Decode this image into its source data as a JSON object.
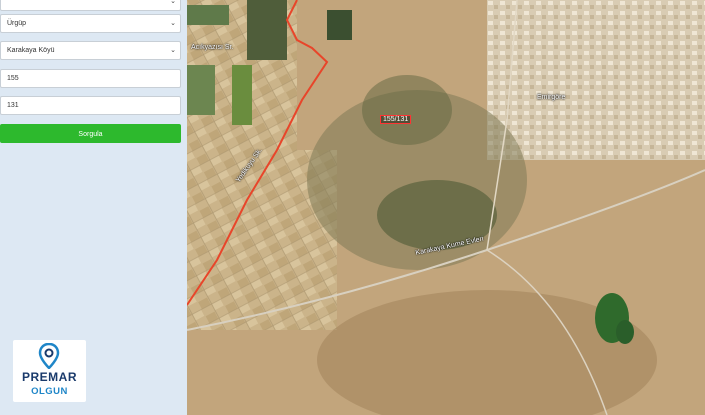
{
  "form": {
    "district_select": "Ürgüp",
    "neighborhood_select": "Karakaya Köyü",
    "block_input": "155",
    "parcel_input": "131",
    "query_button": "Sorgula"
  },
  "map": {
    "place_label_1": "Acıkyazısı Sr.",
    "place_label_2": "Emirgöre",
    "road_label_1": "Yedikuyu Sk.",
    "road_label_2": "Karakaya Kume Evleri",
    "parcel_label": "155/131",
    "boundary_color": "#e8452a"
  },
  "logo": {
    "brand": "PREMAR",
    "sub": "OLGUN",
    "brand_color": "#1a3a6b",
    "accent_color": "#1f86c8"
  }
}
